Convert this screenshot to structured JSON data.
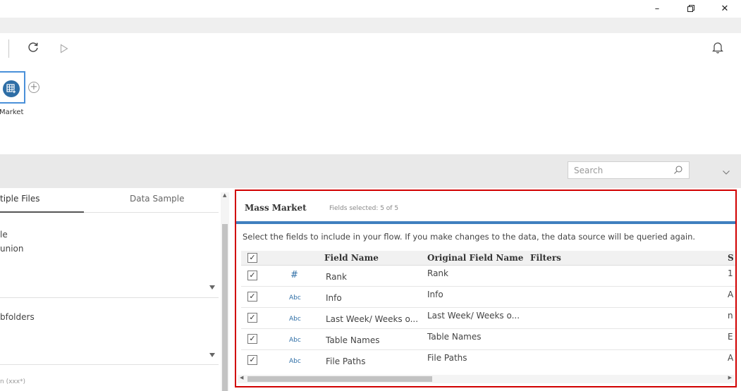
{
  "window": {
    "minimize_label": "–",
    "restore_icon": "restore-icon",
    "close_label": "✕"
  },
  "toolbar": {
    "refresh_icon": "refresh-icon",
    "run_icon": "play-icon",
    "notifications_icon": "bell-icon"
  },
  "canvas": {
    "node_label": "Market",
    "node_icon": "table-add-icon",
    "add_icon": "plus-circle-icon"
  },
  "search": {
    "placeholder": "Search"
  },
  "left_panel": {
    "tabs": [
      {
        "label": "tiple Files",
        "active": true
      },
      {
        "label": "Data Sample",
        "active": false
      }
    ],
    "line1": "le",
    "line2": "union",
    "line3": "bfolders",
    "line4": "n (xxx*)"
  },
  "right_panel": {
    "title": "Mass Market",
    "fields_selected": "Fields selected: 5 of 5",
    "description": "Select the fields to include in your flow. If you make changes to the data, the data source will be queried again.",
    "columns": {
      "field_name": "Field Name",
      "original_field_name": "Original Field Name",
      "filters": "Filters",
      "sample": "S"
    },
    "rows": [
      {
        "type": "#",
        "field_name": "Rank",
        "original": "Rank",
        "sample": "1"
      },
      {
        "type": "Abc",
        "field_name": "Info",
        "original": "Info",
        "sample": "A"
      },
      {
        "type": "Abc",
        "field_name": "Last Week/ Weeks o...",
        "original": "Last Week/ Weeks o...",
        "sample": "n"
      },
      {
        "type": "Abc",
        "field_name": "Table Names",
        "original": "Table Names",
        "sample": "E"
      },
      {
        "type": "Abc",
        "field_name": "File Paths",
        "original": "File Paths",
        "sample": "A"
      }
    ]
  },
  "colors": {
    "accent_blue": "#3f7fbf",
    "highlight_red": "#d10000",
    "node_blue": "#2e6ea6"
  }
}
